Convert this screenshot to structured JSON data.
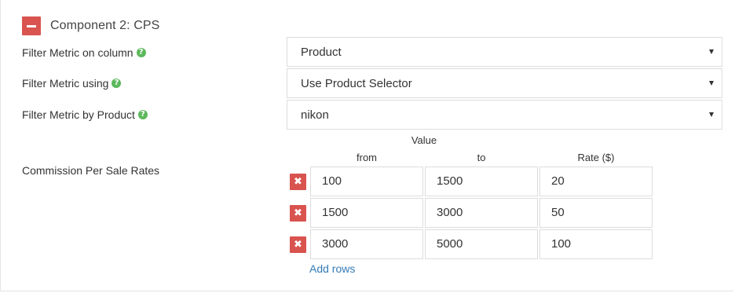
{
  "section": {
    "title": "Component 2: CPS",
    "collapse_icon": "minus-icon",
    "collapse_color": "#d9534f"
  },
  "fields": [
    {
      "label": "Filter Metric on column",
      "value": "Product",
      "has_help": true
    },
    {
      "label": "Filter Metric using",
      "value": "Use Product Selector",
      "has_help": true
    },
    {
      "label": "Filter Metric by Product",
      "value": "nikon",
      "has_help": true
    }
  ],
  "help_icon": {
    "glyph": "?",
    "color": "#5cb85c"
  },
  "rates": {
    "label": "Commission Per Sale Rates",
    "group_header": "Value",
    "headers": {
      "from": "from",
      "to": "to",
      "rate": "Rate ($)"
    },
    "delete_glyph": "✖",
    "rows": [
      {
        "from": "100",
        "to": "1500",
        "rate": "20"
      },
      {
        "from": "1500",
        "to": "3000",
        "rate": "50"
      },
      {
        "from": "3000",
        "to": "5000",
        "rate": "100"
      }
    ],
    "add_rows_label": "Add rows"
  },
  "colors": {
    "danger": "#d9534f",
    "success": "#5cb85c",
    "link": "#337ab7"
  }
}
